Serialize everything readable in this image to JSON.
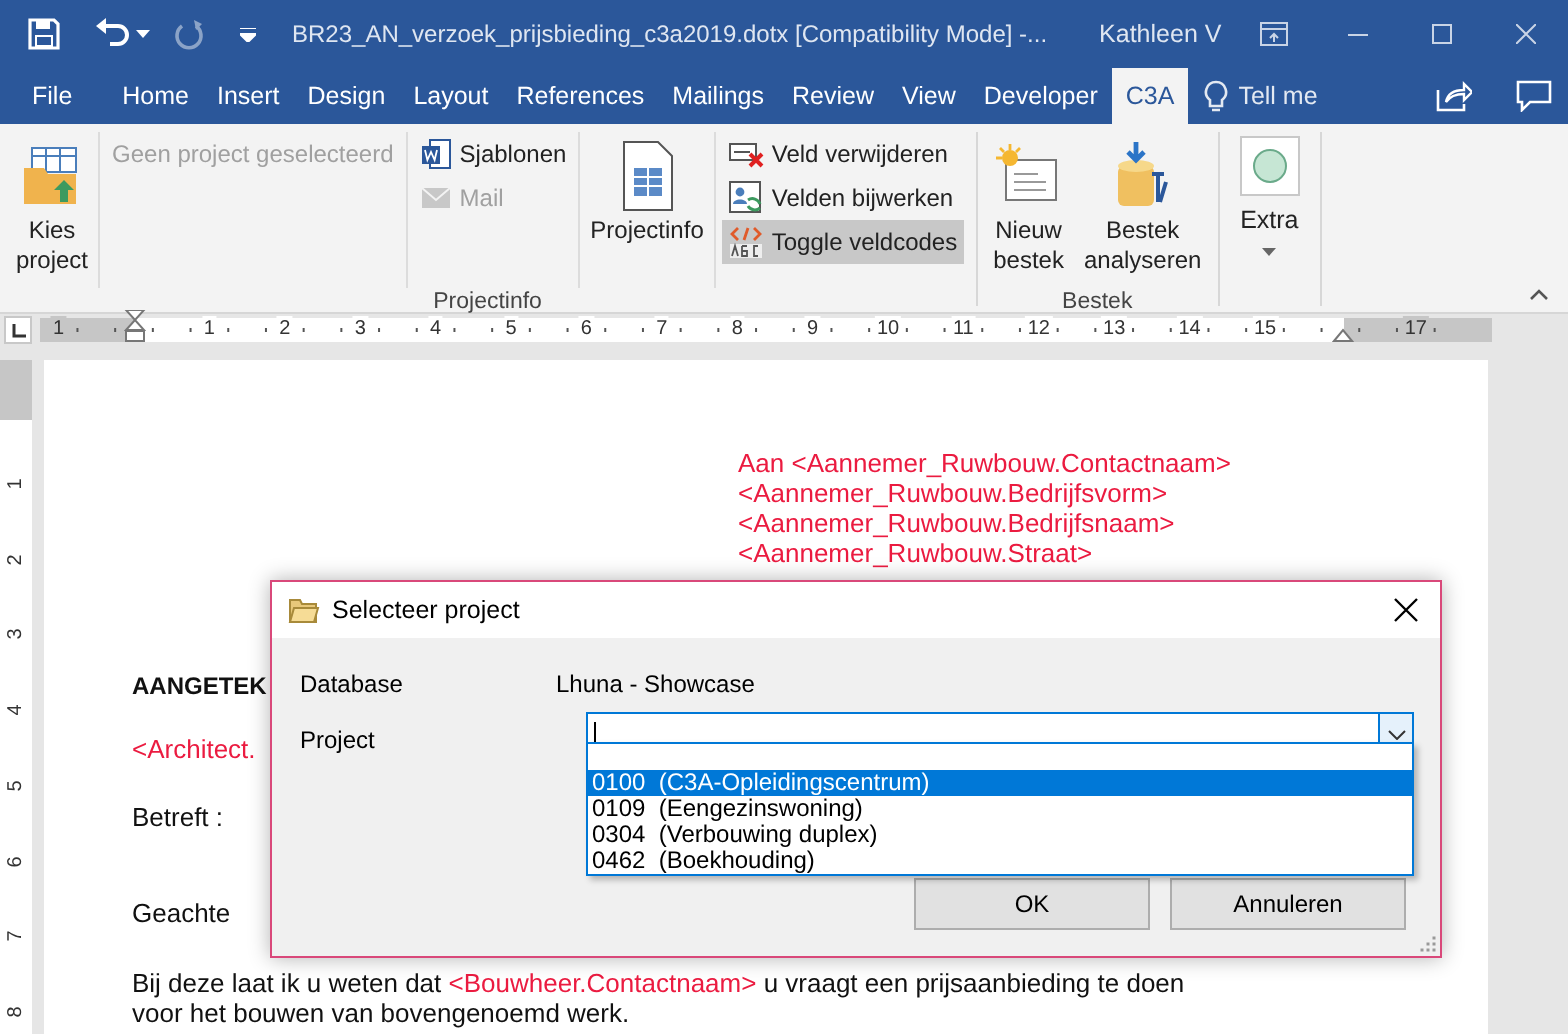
{
  "title_bar": {
    "document_title": "BR23_AN_verzoek_prijsbieding_c3a2019.dotx [Compatibility Mode]  -...",
    "user": "Kathleen V",
    "redo_disabled": true
  },
  "menu_tabs": [
    {
      "label": "File",
      "selected": false
    },
    {
      "label": "Home",
      "selected": false
    },
    {
      "label": "Insert",
      "selected": false
    },
    {
      "label": "Design",
      "selected": false
    },
    {
      "label": "Layout",
      "selected": false
    },
    {
      "label": "References",
      "selected": false
    },
    {
      "label": "Mailings",
      "selected": false
    },
    {
      "label": "Review",
      "selected": false
    },
    {
      "label": "View",
      "selected": false
    },
    {
      "label": "Developer",
      "selected": false
    },
    {
      "label": "C3A",
      "selected": true
    }
  ],
  "tell_me": {
    "label": "Tell me"
  },
  "ribbon": {
    "groups": [
      {
        "label": "Projectinfo",
        "column_dividers": true,
        "columns": [
          [
            {
              "kind": "large",
              "label": "Kies project",
              "disabled": false,
              "active": false
            }
          ],
          [
            {
              "kind": "small",
              "label": "Geen project geselecteerd",
              "disabled": true,
              "active": false
            }
          ],
          [
            {
              "kind": "small",
              "label": "Sjablonen",
              "disabled": false,
              "active": false
            },
            {
              "kind": "small",
              "label": "Mail",
              "disabled": true,
              "active": false
            }
          ],
          [
            {
              "kind": "large",
              "label": "Projectinfo",
              "disabled": false,
              "active": false
            }
          ],
          [
            {
              "kind": "small",
              "label": "Veld verwijderen",
              "disabled": false,
              "active": false
            },
            {
              "kind": "small",
              "label": "Velden bijwerken",
              "disabled": false,
              "active": false
            },
            {
              "kind": "small",
              "label": "Toggle veldcodes",
              "disabled": false,
              "active": true
            }
          ]
        ]
      },
      {
        "label": "Bestek",
        "column_dividers": false,
        "columns": [
          [
            {
              "kind": "large",
              "label": "Nieuw bestek",
              "disabled": false,
              "active": false
            }
          ],
          [
            {
              "kind": "large",
              "label": "Bestek analyseren",
              "disabled": false,
              "active": false
            }
          ]
        ]
      },
      {
        "column_dividers": false,
        "columns": [
          [
            {
              "kind": "dropdown",
              "label": "Extra",
              "disabled": false,
              "active": false
            }
          ]
        ]
      }
    ]
  },
  "ruler": {
    "left_labels": [
      "1"
    ],
    "labels": [
      "1",
      "2",
      "3",
      "4",
      "5",
      "6",
      "7",
      "8",
      "9",
      "10",
      "11",
      "12",
      "13",
      "14",
      "15"
    ],
    "right_labels": [
      "17"
    ],
    "vertical_labels": [
      "1",
      "2",
      "3",
      "4",
      "5",
      "6",
      "7",
      "8"
    ]
  },
  "document": {
    "address_lines": [
      "Aan <Aannemer_Ruwbouw.Contactnaam>",
      "<Aannemer_Ruwbouw.Bedrijfsvorm>",
      "<Aannemer_Ruwbouw.Bedrijfsnaam>",
      "<Aannemer_Ruwbouw.Straat>"
    ],
    "heading": "AANGETEK",
    "architect_line": "<Architect.",
    "subject_label": "Betreft :",
    "salutation": "Geachte",
    "body": [
      {
        "text": "Bij deze laat ik u weten dat ",
        "field": false
      },
      {
        "text": "<Bouwheer.Contactnaam>",
        "field": true
      },
      {
        "text": " u vraagt een prijsaanbieding te doen voor het bouwen van bovengenoemd werk.",
        "field": false
      }
    ]
  },
  "dialog": {
    "title": "Selecteer project",
    "database_label": "Database",
    "database_value": "Lhuna - Showcase",
    "project_label": "Project",
    "options": [
      {
        "label": "0100  (C3A-Opleidingscentrum)",
        "selected": true
      },
      {
        "label": "0109  (Eengezinswoning)",
        "selected": false
      },
      {
        "label": "0304  (Verbouwing duplex)",
        "selected": false
      },
      {
        "label": "0462  (Boekhouding)",
        "selected": false
      }
    ],
    "buttons": [
      "OK",
      "Annuleren"
    ]
  }
}
